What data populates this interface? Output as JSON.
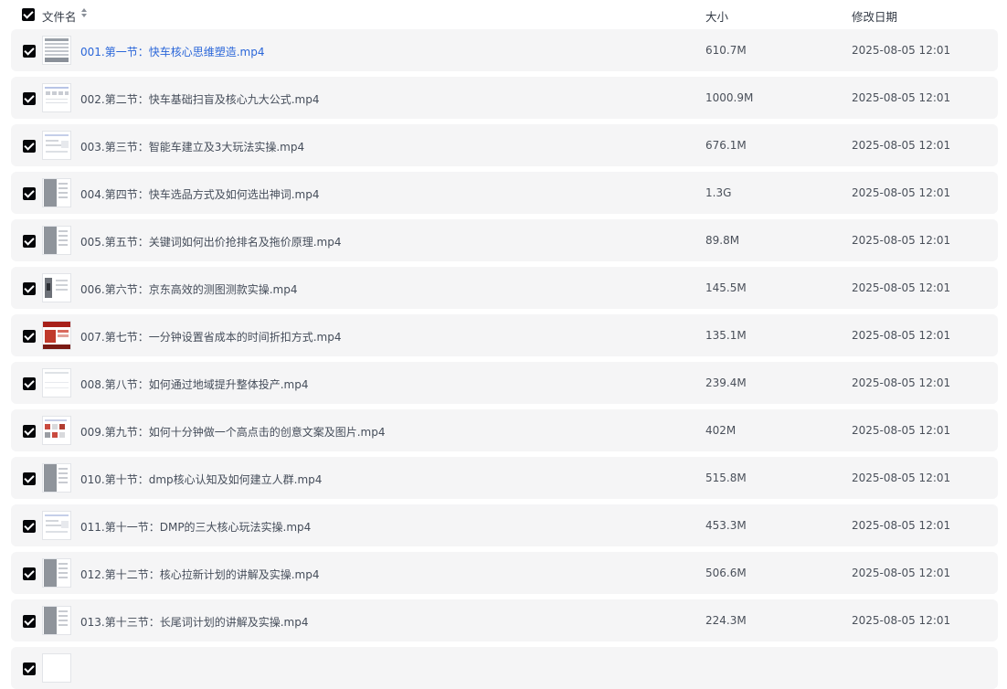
{
  "header": {
    "name_label": "文件名",
    "size_label": "大小",
    "date_label": "修改日期"
  },
  "files": [
    {
      "name": "001.第一节：快车核心思维塑造.mp4",
      "size": "610.7M",
      "date": "2025-08-05 12:01",
      "thumb": "doc-gray-icon"
    },
    {
      "name": "002.第二节：快车基础扫盲及核心九大公式.mp4",
      "size": "1000.9M",
      "date": "2025-08-05 12:01",
      "thumb": "dashboard-light-icon"
    },
    {
      "name": "003.第三节：智能车建立及3大玩法实操.mp4",
      "size": "676.1M",
      "date": "2025-08-05 12:01",
      "thumb": "form-light-icon"
    },
    {
      "name": "004.第四节：快车选品方式及如何选出神词.mp4",
      "size": "1.3G",
      "date": "2025-08-05 12:01",
      "thumb": "sidebar-gray-icon"
    },
    {
      "name": "005.第五节：关键词如何出价抢排名及拖价原理.mp4",
      "size": "89.8M",
      "date": "2025-08-05 12:01",
      "thumb": "sidebar-gray-icon"
    },
    {
      "name": "006.第六节：京东高效的测图测款实操.mp4",
      "size": "145.5M",
      "date": "2025-08-05 12:01",
      "thumb": "product-image-icon"
    },
    {
      "name": "007.第七节：一分钟设置省成本的时间折扣方式.mp4",
      "size": "135.1M",
      "date": "2025-08-05 12:01",
      "thumb": "red-slide-icon"
    },
    {
      "name": "008.第八节：如何通过地域提升整体投产.mp4",
      "size": "239.4M",
      "date": "2025-08-05 12:01",
      "thumb": "blank-page-icon"
    },
    {
      "name": "009.第九节：如何十分钟做一个高点击的创意文案及图片.mp4",
      "size": "402M",
      "date": "2025-08-05 12:01",
      "thumb": "product-grid-icon"
    },
    {
      "name": "010.第十节：dmp核心认知及如何建立人群.mp4",
      "size": "515.8M",
      "date": "2025-08-05 12:01",
      "thumb": "sidebar-gray-icon"
    },
    {
      "name": "011.第十一节：DMP的三大核心玩法实操.mp4",
      "size": "453.3M",
      "date": "2025-08-05 12:01",
      "thumb": "form-light-icon"
    },
    {
      "name": "012.第十二节：核心拉新计划的讲解及实操.mp4",
      "size": "506.6M",
      "date": "2025-08-05 12:01",
      "thumb": "sidebar-gray-icon"
    },
    {
      "name": "013.第十三节：长尾词计划的讲解及实操.mp4",
      "size": "224.3M",
      "date": "2025-08-05 12:01",
      "thumb": "sidebar-gray-icon"
    }
  ]
}
